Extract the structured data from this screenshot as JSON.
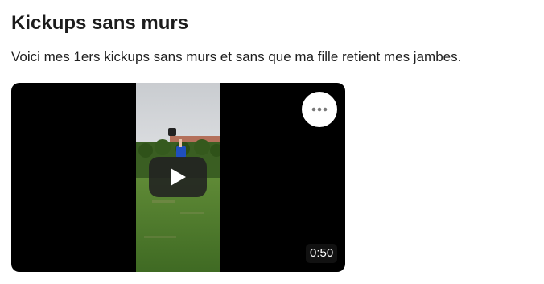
{
  "post": {
    "title": "Kickups sans murs",
    "text": "Voici mes 1ers kickups sans murs et sans que ma fille retient mes jambes."
  },
  "video": {
    "duration": "0:50",
    "play_icon": "play-icon",
    "more_icon": "more-horizontal-icon"
  },
  "colors": {
    "video_background": "#000000",
    "play_button": "#212121",
    "title_text": "#1c1c1c"
  }
}
